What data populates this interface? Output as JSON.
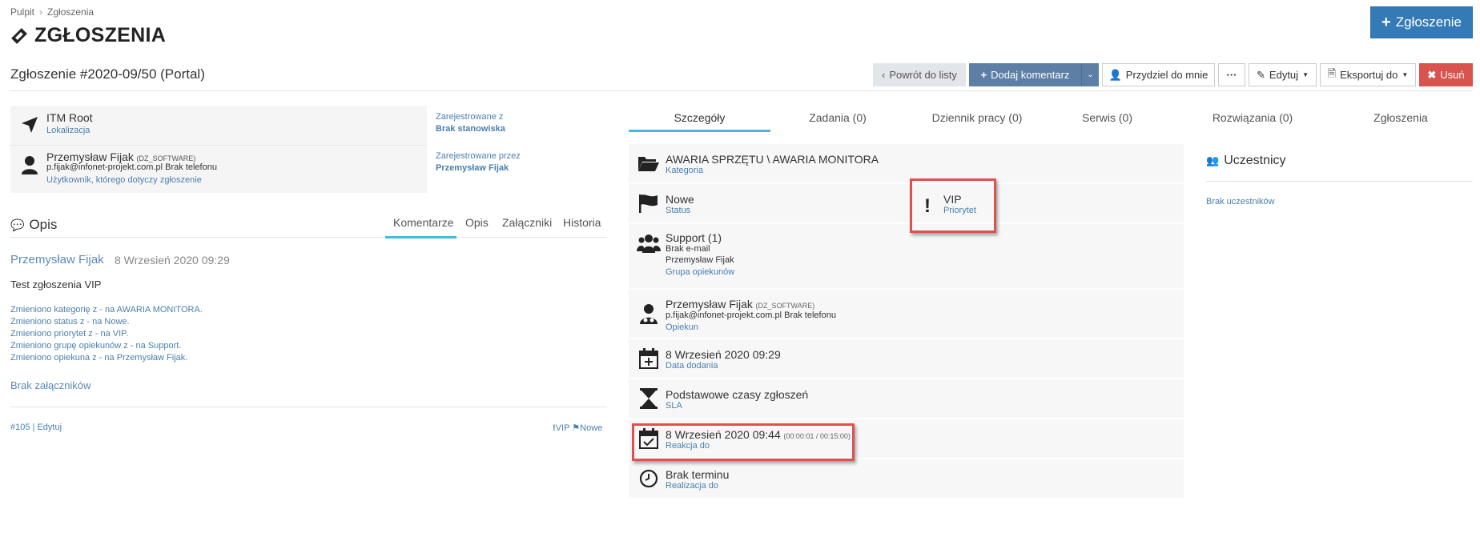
{
  "breadcrumb": {
    "home": "Pulpit",
    "current": "Zgłoszenia"
  },
  "page_title": "ZGŁOSZENIA",
  "new_button": "Zgłoszenie",
  "ticket_title": "Zgłoszenie #2020-09/50 (Portal)",
  "toolbar": {
    "back": "Powrót do listy",
    "add_comment": "Dodaj komentarz",
    "assign_me": "Przydziel do mnie",
    "more": "···",
    "edit": "Edytuj",
    "export": "Eksportuj do",
    "delete": "Usuń"
  },
  "info": {
    "location_name": "ITM Root",
    "location_label": "Lokalizacja",
    "user_name": "Przemysław Fijak",
    "user_company": "(DZ_SOFTWARE)",
    "user_contact": "p.fijak@infonet-projekt.com.pl Brak telefonu",
    "user_label": "Użytkownik, którego dotyczy zgłoszenie",
    "registered_from_label": "Zarejestrowane z",
    "registered_from_value": "Brak stanowiska",
    "registered_by_label": "Zarejestrowane przez",
    "registered_by_value": "Przemysław Fijak"
  },
  "opis": {
    "title": "Opis",
    "tabs": [
      "Komentarze",
      "Opis",
      "Załączniki",
      "Historia"
    ],
    "comment": {
      "author": "Przemysław Fijak",
      "date": "8 Wrzesień 2020 09:29",
      "body": "Test zgłoszenia VIP",
      "changes": [
        "Zmieniono kategorię z - na AWARIA MONITORA.",
        "Zmieniono status z - na Nowe.",
        "Zmieniono priorytet z - na VIP.",
        "Zmieniono grupę opiekunów z - na Support.",
        "Zmieniono opiekuna z - na Przemysław Fijak."
      ],
      "no_attachments": "Brak załączników",
      "footer_id": "#105",
      "footer_sep": "|",
      "footer_edit": "Edytuj",
      "footer_priority": "VIP",
      "footer_status": "Nowe"
    }
  },
  "right_tabs": [
    "Szczegóły",
    "Zadania (0)",
    "Dziennik pracy (0)",
    "Serwis (0)",
    "Rozwiązania (0)",
    "Zgłoszenia"
  ],
  "details": {
    "category_value": "AWARIA SPRZĘTU \\ AWARIA MONITORA",
    "category_label": "Kategoria",
    "status_value": "Nowe",
    "status_label": "Status",
    "priority_value": "VIP",
    "priority_label": "Priorytet",
    "group_value": "Support (1)",
    "group_email": "Brak e-mail",
    "group_member": "Przemysław Fijak",
    "group_label": "Grupa opiekunów",
    "owner_value": "Przemysław Fijak",
    "owner_company": "(DZ_SOFTWARE)",
    "owner_contact": "p.fijak@infonet-projekt.com.pl Brak telefonu",
    "owner_label": "Opiekun",
    "added_value": "8 Wrzesień 2020 09:29",
    "added_label": "Data dodania",
    "sla_value": "Podstawowe czasy zgłoszeń",
    "sla_label": "SLA",
    "reaction_value": "8 Wrzesień 2020 09:44",
    "reaction_timer": "(00:00:01 / 00:15:00)",
    "reaction_label": "Reakcja do",
    "realization_value": "Brak terminu",
    "realization_label": "Realizacja do"
  },
  "participants": {
    "title": "Uczestnicy",
    "empty": "Brak uczestników"
  },
  "colors": {
    "primary": "#337ab7",
    "accent": "#46b8da",
    "danger": "#d9534f",
    "link": "#4a7fb0"
  }
}
